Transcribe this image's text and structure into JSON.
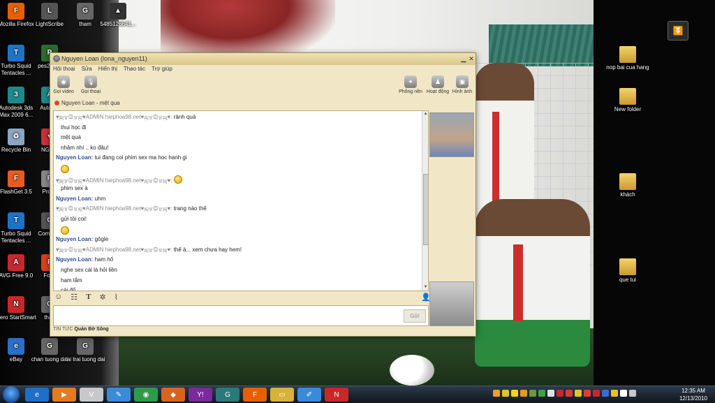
{
  "desktop": {
    "icons_left": [
      {
        "label": "Mozilla Firefox",
        "icon": "firefox-icon",
        "color": "#e66000",
        "glyph": "F"
      },
      {
        "label": "LightScribe",
        "icon": "lightscribe-icon",
        "color": "#555555",
        "glyph": "L"
      },
      {
        "label": "tham",
        "icon": "file-icon",
        "color": "#666666",
        "glyph": "G"
      },
      {
        "label": "5485126641...",
        "icon": "image-icon",
        "color": "#333333",
        "glyph": "▲"
      },
      {
        "label": "Turbo Squid Tentacles ...",
        "icon": "turbosquid-icon",
        "color": "#1e73c8",
        "glyph": "T"
      },
      {
        "label": "pes2 Sho",
        "icon": "game-icon",
        "color": "#2f6b2f",
        "glyph": "P"
      },
      {
        "label": "Autodesk 3ds Max 2009 6...",
        "icon": "3dsmax-icon",
        "color": "#1e8a8a",
        "glyph": "3"
      },
      {
        "label": "Auto 20",
        "icon": "autodesk-icon",
        "color": "#1e8a8a",
        "glyph": "A"
      },
      {
        "label": "Recycle Bin",
        "icon": "recycle-bin-icon",
        "color": "#8aa6c1",
        "glyph": "♻"
      },
      {
        "label": "NGOC",
        "icon": "heart-icon",
        "color": "#c8323c",
        "glyph": "♥"
      },
      {
        "label": "FlashGet 3.5",
        "icon": "flashget-icon",
        "color": "#e65c1e",
        "glyph": "F"
      },
      {
        "label": "Pro G",
        "icon": "app-icon",
        "color": "#888888",
        "glyph": "P"
      },
      {
        "label": "Turbo Squid Tentacles ...",
        "icon": "turbosquid-icon",
        "color": "#1e73c8",
        "glyph": "T"
      },
      {
        "label": "Com Sho",
        "icon": "app-icon",
        "color": "#555555",
        "glyph": "C"
      },
      {
        "label": "AVG Free 9.0",
        "icon": "avg-icon",
        "color": "#c8282d",
        "glyph": "A"
      },
      {
        "label": "Foxit",
        "icon": "foxit-icon",
        "color": "#d9401e",
        "glyph": "F"
      },
      {
        "label": "Nero StartSmart",
        "icon": "nero-icon",
        "color": "#c82828",
        "glyph": "N"
      },
      {
        "label": "than",
        "icon": "file-icon",
        "color": "#666666",
        "glyph": "G"
      },
      {
        "label": "eBay",
        "icon": "ebay-icon",
        "color": "#2a6fc8",
        "glyph": "e"
      },
      {
        "label": "chan tuong dai",
        "icon": "file-icon",
        "color": "#666666",
        "glyph": "G"
      },
      {
        "label": "tai trai tuong dai",
        "icon": "file-icon",
        "color": "#666666",
        "glyph": "G"
      }
    ],
    "icons_right": [
      {
        "label": "nop bai cua hang",
        "icon": "folder-icon"
      },
      {
        "label": "New folder",
        "icon": "folder-icon"
      },
      {
        "label": "khách",
        "icon": "folder-icon"
      },
      {
        "label": "que tui",
        "icon": "folder-icon"
      }
    ]
  },
  "chat_window": {
    "title": "Nguyen Loan (lona_nguyen11)",
    "menu": [
      "Hội thoại",
      "Sửa",
      "Hiển thị",
      "Thao tác",
      "Trợ giúp"
    ],
    "toolbar": {
      "video_call": "Gọi video",
      "voice_call": "Gọi thoại",
      "room": "Phông nền",
      "activity": "Hoạt động",
      "images": "Hình ảnh"
    },
    "status_line": "Nguyen Loan - mệt qua",
    "messages": [
      {
        "sender": "♥҉ஜ۩۞۩ஜ♥ADMIN hiephoa98.net♥ஜ۩۞۩ஜ♥:",
        "text": "rảnh quá",
        "loan": false
      },
      {
        "sender": "",
        "text": "thui học đi",
        "loan": false
      },
      {
        "sender": "",
        "text": "mệt quá",
        "loan": false
      },
      {
        "sender": "",
        "text": "nhâm nhí .. ko đâu!",
        "loan": false
      },
      {
        "sender": "Nguyen Loan:",
        "text": "tui đang coi phim sex ma hoc hanh gi",
        "loan": true
      },
      {
        "sender": "",
        "text": "",
        "loan": false,
        "emoticon": true
      },
      {
        "sender": "♥҉ஜ۩۞۩ஜ♥ADMIN hiephoa98.net♥ஜ۩۞۩ஜ♥:",
        "text": "",
        "loan": false,
        "emoticon": true
      },
      {
        "sender": "",
        "text": "phim sex à",
        "loan": false
      },
      {
        "sender": "Nguyen Loan:",
        "text": "uhm",
        "loan": true
      },
      {
        "sender": "♥҉ஜ۩۞۩ஜ♥ADMIN hiephoa98.net♥ஜ۩۞۩ஜ♥:",
        "text": "trang nào thế",
        "loan": false
      },
      {
        "sender": "",
        "text": "gửi tôi coi!",
        "loan": false
      },
      {
        "sender": "",
        "text": "",
        "loan": false,
        "emoticon": true
      },
      {
        "sender": "Nguyen Loan:",
        "text": "gôgle",
        "loan": true
      },
      {
        "sender": "♥҉ஜ۩۞۩ஜ♥ADMIN hiephoa98.net♥ஜ۩۞۩ஜ♥:",
        "text": "thế à... xem chưa hay hem!",
        "loan": false
      },
      {
        "sender": "Nguyen Loan:",
        "text": "ham hố",
        "loan": true
      },
      {
        "sender": "",
        "text": "nghe sex cái là hỏi liền",
        "loan": false
      },
      {
        "sender": "",
        "text": "ham lắm",
        "loan": false
      },
      {
        "sender": "",
        "text": "cái đổ",
        "loan": false
      }
    ],
    "send_label": "Gửi",
    "news": {
      "prefix": "TIN TỨC",
      "headline": "Quán Bờ Sông"
    }
  },
  "taskbar": {
    "apps": [
      {
        "name": "ie-icon",
        "color": "#1e6fc8",
        "glyph": "e"
      },
      {
        "name": "media-player-icon",
        "color": "#e67a1e",
        "glyph": "▶"
      },
      {
        "name": "unikey-icon",
        "color": "#c8c8c8",
        "glyph": "V"
      },
      {
        "name": "pen-icon",
        "color": "#3a8ad9",
        "glyph": "✎"
      },
      {
        "name": "chrome-icon",
        "color": "#2f9a4a",
        "glyph": "◉"
      },
      {
        "name": "app-icon",
        "color": "#d9631e",
        "glyph": "◆"
      },
      {
        "name": "yahoo-messenger-icon",
        "color": "#7a2a9a",
        "glyph": "Y!"
      },
      {
        "name": "garena-icon",
        "color": "#2a7a7a",
        "glyph": "G"
      },
      {
        "name": "firefox-icon",
        "color": "#e66000",
        "glyph": "F"
      },
      {
        "name": "explorer-icon",
        "color": "#d9b23a",
        "glyph": "▭"
      },
      {
        "name": "paint-icon",
        "color": "#3a8ad9",
        "glyph": "✐"
      },
      {
        "name": "nero-icon",
        "color": "#c82828",
        "glyph": "N"
      }
    ],
    "tray_colors": [
      "#e6a31e",
      "#e6c31e",
      "#ffd400",
      "#e69a1e",
      "#6a9a3a",
      "#3aa63a",
      "#e0e0e0",
      "#c82828",
      "#d93a3a",
      "#e6c31e",
      "#e63a3a",
      "#c82828",
      "#3a6ad9",
      "#e6c31e",
      "#ffffff",
      "#c8c8c8"
    ],
    "time": "12:35 AM",
    "date": "12/13/2010"
  }
}
